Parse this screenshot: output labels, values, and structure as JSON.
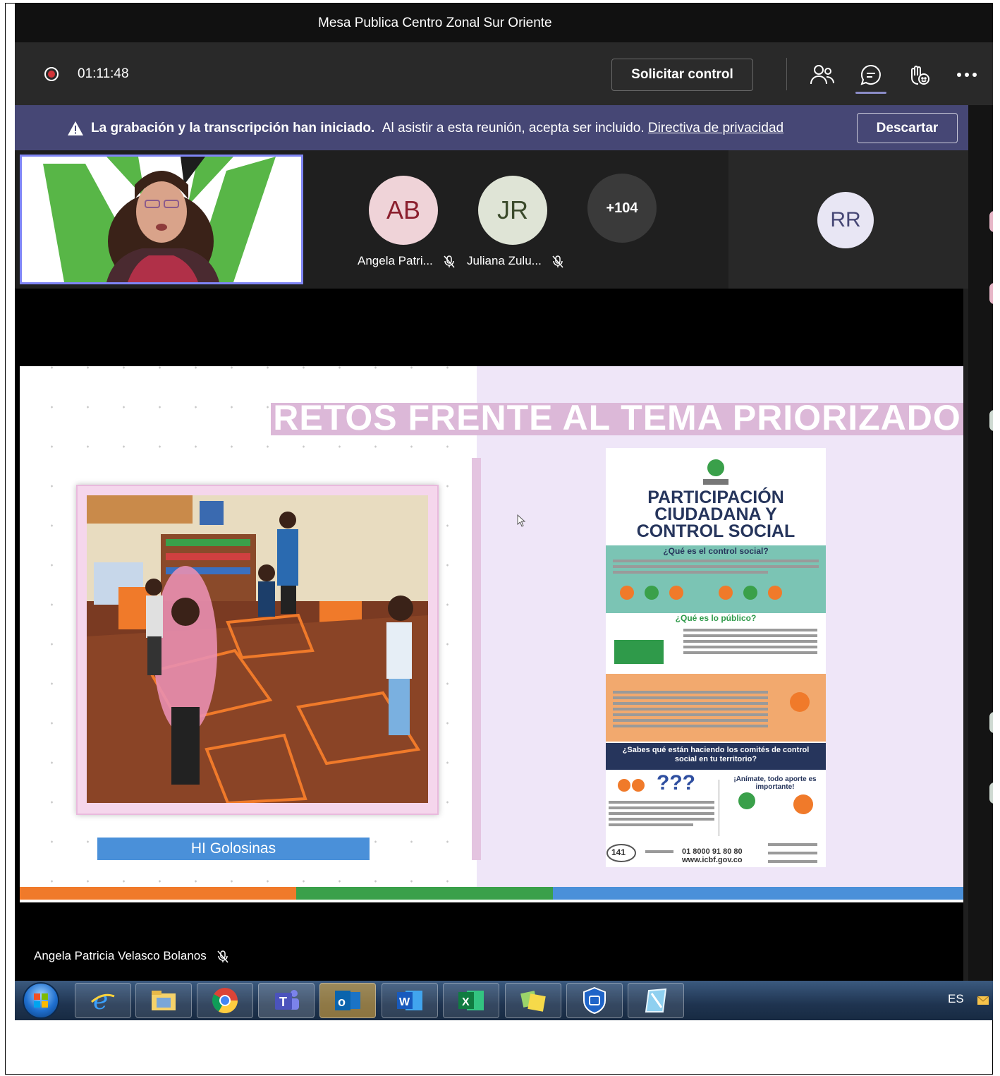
{
  "window": {
    "title": "Mesa Publica Centro Zonal Sur Oriente"
  },
  "controls": {
    "timer": "01:11:48",
    "request_control_label": "Solicitar control",
    "icons": [
      "participants-icon",
      "chat-icon",
      "reactions-icon",
      "more-icon"
    ]
  },
  "banner": {
    "bold_text": "La grabación y la transcripción han iniciado.",
    "text": "Al asistir a esta reunión, acepta ser incluido.",
    "link": "Directiva de privacidad",
    "dismiss_label": "Descartar"
  },
  "participants": [
    {
      "initials": "AB",
      "name": "Angela Patri...",
      "muted": true,
      "bg": "#efd3d8",
      "fg": "#8b1f2e"
    },
    {
      "initials": "JR",
      "name": "Juliana Zulu...",
      "muted": true,
      "bg": "#dfe4d6",
      "fg": "#3b4a2b"
    }
  ],
  "overflow": {
    "label": "+104"
  },
  "rr": {
    "initials": "RR",
    "bg": "#e8e6f4",
    "fg": "#464775"
  },
  "slide": {
    "title": "RETOS FRENTE AL TEMA PRIORIZADO",
    "caption": "HI Golosinas",
    "poster": {
      "title_lines": [
        "PARTICIPACIÓN",
        "CIUDADANA Y",
        "CONTROL SOCIAL"
      ],
      "q1": "¿Qué es el control social?",
      "q2": "¿Qué es lo público?",
      "q3": "¿Sabes qué están haciendo los comités de control social en tu territorio?",
      "cta": "¡Anímate, todo aporte es importante!",
      "question_marks": "???",
      "line_141": "141",
      "phone": "01 8000 91 80 80",
      "web": "www.icbf.gov.co"
    }
  },
  "speaker": {
    "name": "Angela Patricia Velasco Bolanos",
    "muted": true
  },
  "taskbar": {
    "apps": [
      "internet-explorer-icon",
      "file-explorer-icon",
      "chrome-icon",
      "teams-icon",
      "outlook-icon",
      "word-icon",
      "excel-icon",
      "sticky-notes-icon",
      "security-icon",
      "notepad-icon"
    ],
    "language": "ES"
  },
  "colors": {
    "accent": "#7f85f5",
    "banner": "#464775",
    "recording": "#d13438"
  }
}
